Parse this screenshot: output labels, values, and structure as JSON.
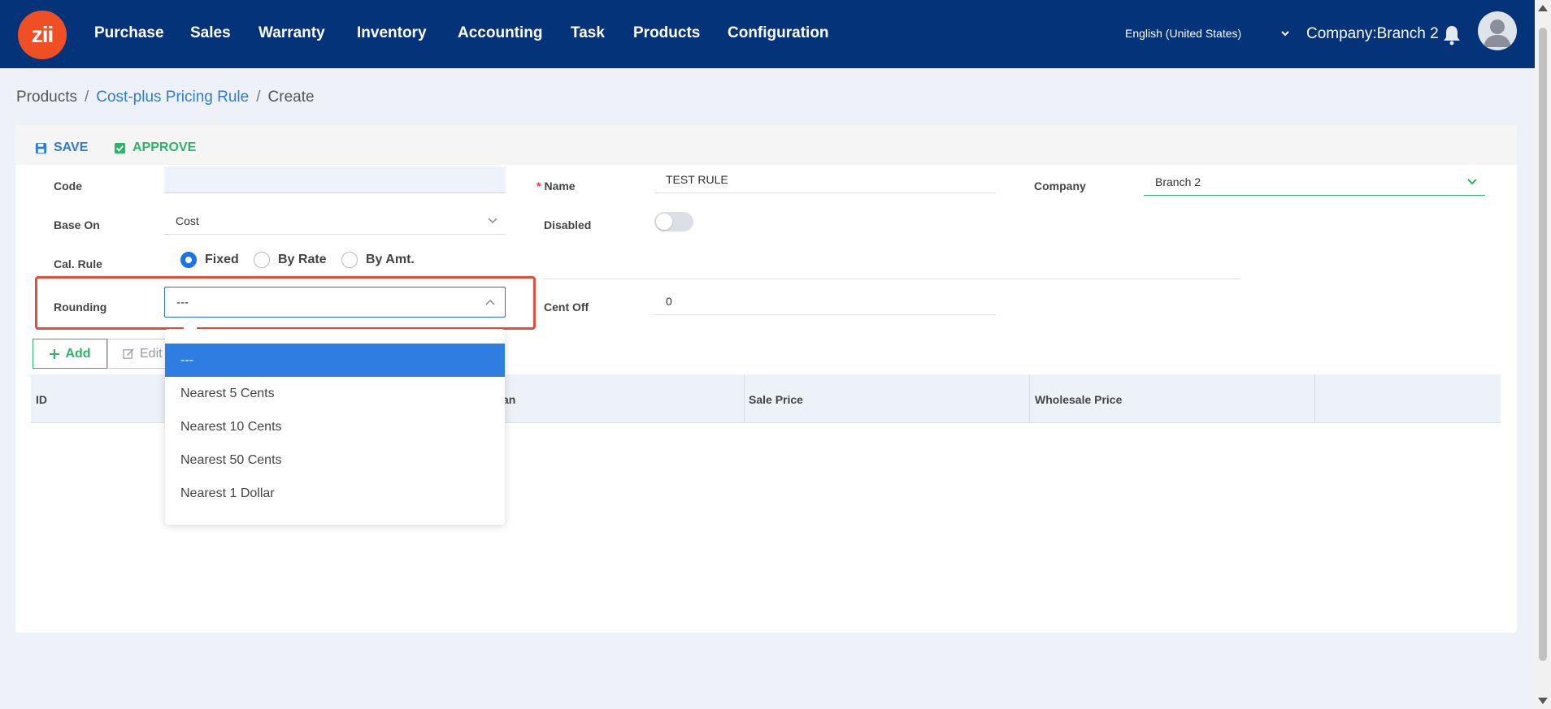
{
  "app": {
    "logo_text": "zii"
  },
  "nav": {
    "items": [
      "Purchase",
      "Sales",
      "Warranty",
      "Inventory",
      "Accounting",
      "Task",
      "Products",
      "Configuration"
    ],
    "language": "English (United States)",
    "company": "Company:Branch 2"
  },
  "breadcrumb": {
    "root": "Products",
    "section": "Cost-plus Pricing Rule",
    "current": "Create"
  },
  "toolbar": {
    "save_label": "SAVE",
    "approve_label": "APPROVE"
  },
  "form": {
    "code_label": "Code",
    "code_value": "",
    "name_label": "Name",
    "name_value": "TEST RULE",
    "company_label": "Company",
    "company_value": "Branch 2",
    "base_on_label": "Base On",
    "base_on_value": "Cost",
    "disabled_label": "Disabled",
    "disabled_value": false,
    "cal_rule_label": "Cal. Rule",
    "cal_rule_options": [
      "Fixed",
      "By Rate",
      "By Amt."
    ],
    "cal_rule_selected": "Fixed",
    "rounding_label": "Rounding",
    "rounding_value": "---",
    "cent_off_label": "Cent Off",
    "cent_off_value": "0"
  },
  "grid_buttons": {
    "add_label": "Add",
    "edit_label": "Edit"
  },
  "table": {
    "columns": [
      "ID",
      "an",
      "Sale Price",
      "Wholesale Price"
    ]
  },
  "dropdown": {
    "options": [
      "---",
      "Nearest 5 Cents",
      "Nearest 10 Cents",
      "Nearest 50 Cents",
      "Nearest 1 Dollar"
    ],
    "selected_index": 0
  },
  "colors": {
    "nav_bg": "#05337a",
    "logo_bg": "#f04e23",
    "primary": "#2f7bd4",
    "success": "#2fb36a",
    "highlight": "#e74c3c"
  }
}
